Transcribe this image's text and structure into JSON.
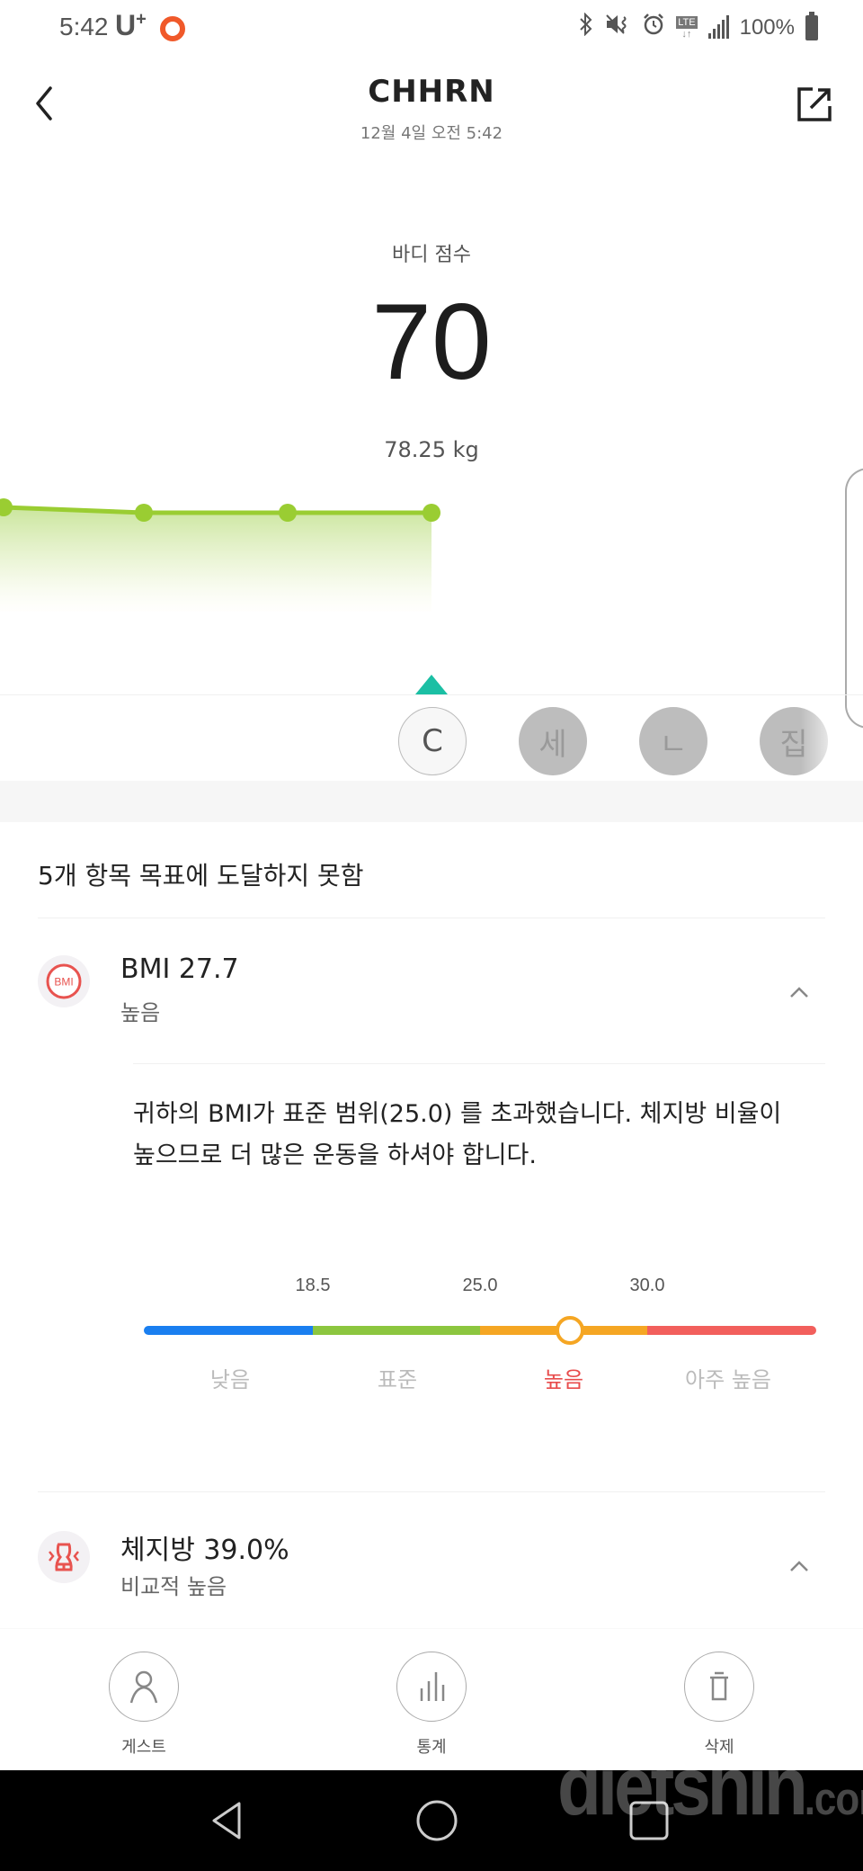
{
  "status_bar": {
    "time": "5:42",
    "carrier": "U",
    "carrier_plus": "+",
    "battery": "100%",
    "icons": [
      "bluetooth-icon",
      "vibrate-icon",
      "alarm-icon",
      "lte-icon",
      "signal-icon",
      "battery-icon"
    ],
    "lte": "LTE"
  },
  "header": {
    "title": "CHHRN",
    "subtitle": "12월 4일 오전 5:42",
    "back_icon": "chevron-left-icon",
    "share_icon": "share-icon"
  },
  "score": {
    "label": "바디 점수",
    "value": "70",
    "weight": "78.25 kg"
  },
  "trend": {
    "points": [
      70.3,
      70,
      70,
      70
    ],
    "line_color": "#9acd32"
  },
  "users": [
    {
      "label": "C",
      "active": true
    },
    {
      "label": "세",
      "active": false
    },
    {
      "label": "ㄴ",
      "active": false
    },
    {
      "label": "집",
      "active": false
    }
  ],
  "goals": {
    "heading": "5개 항목 목표에 도달하지 못함"
  },
  "bmi": {
    "icon_text": "BMI",
    "title": "BMI  27.7",
    "value": 27.7,
    "status": "높음",
    "description": "귀하의 BMI가 표준 범위(25.0) 를 초과했습니다. 체지방 비율이 높으므로 더 많은 운동을 하셔야 합니다.",
    "scale": {
      "ticks": [
        "18.5",
        "25.0",
        "30.0"
      ],
      "categories": [
        "낮음",
        "표준",
        "높음",
        "아주 높음"
      ],
      "current_index": 2,
      "colors": [
        "#1a7ff0",
        "#8cc63f",
        "#f5a623",
        "#f25f5c"
      ]
    }
  },
  "body_fat": {
    "title": "체지방  39.0%",
    "status": "비교적 높음"
  },
  "actions": [
    {
      "label": "게스트",
      "icon": "person-icon"
    },
    {
      "label": "통계",
      "icon": "bar-chart-icon"
    },
    {
      "label": "삭제",
      "icon": "trash-icon"
    }
  ],
  "watermark": {
    "main": "dietshin",
    "suffix": ".com"
  },
  "colors": {
    "accent_teal": "#1bbfa4",
    "alert_red": "#e84c4c",
    "carrier_orange": "#f0592a"
  }
}
